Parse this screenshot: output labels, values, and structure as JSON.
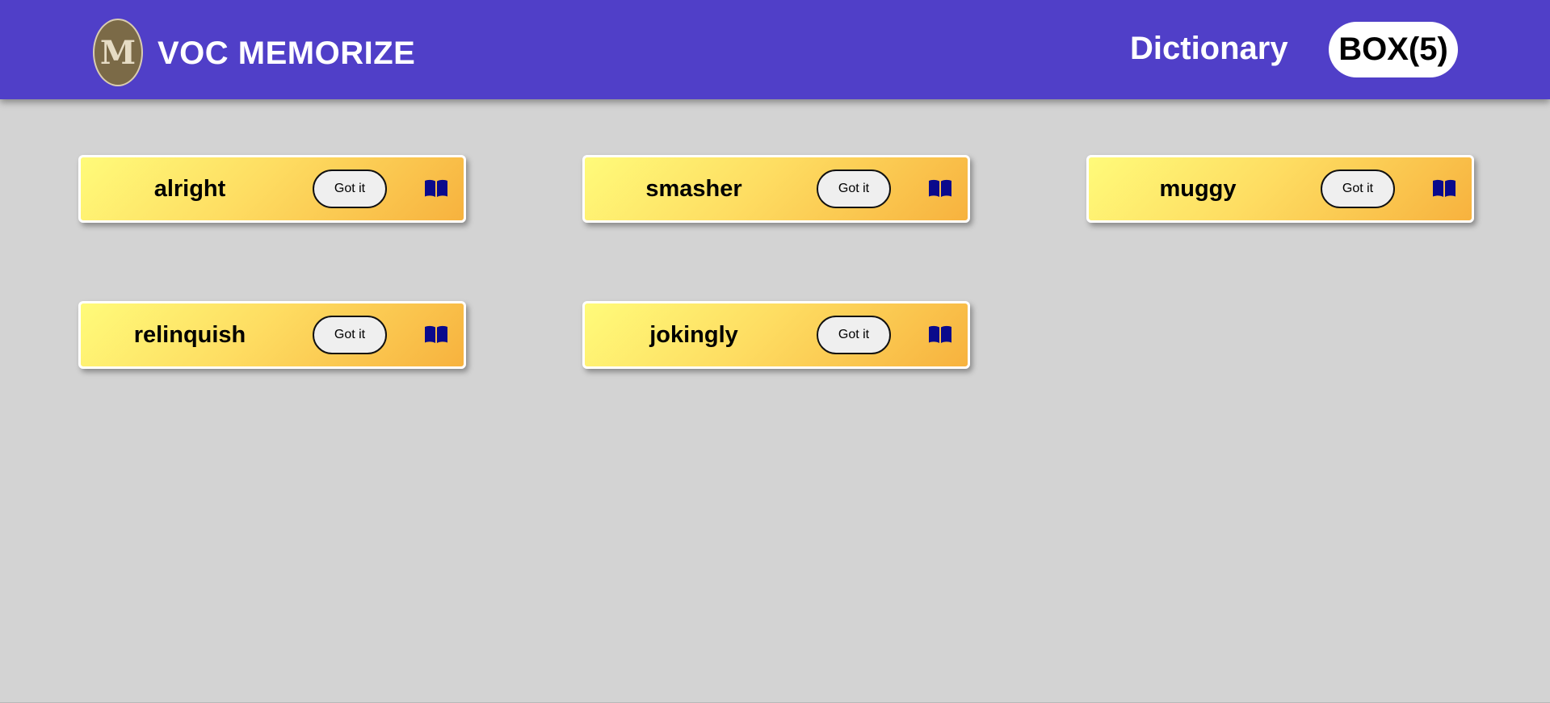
{
  "header": {
    "brand": "VOC MEMORIZE",
    "logo_letter": "M",
    "nav": {
      "dictionary": "Dictionary",
      "box": "BOX(5)"
    },
    "background_color": "#503fc8"
  },
  "cards": [
    {
      "word": "alright",
      "button_label": "Got it",
      "icon": "book-icon"
    },
    {
      "word": "smasher",
      "button_label": "Got it",
      "icon": "book-icon"
    },
    {
      "word": "muggy",
      "button_label": "Got it",
      "icon": "book-icon"
    },
    {
      "word": "relinquish",
      "button_label": "Got it",
      "icon": "book-icon"
    },
    {
      "word": "jokingly",
      "button_label": "Got it",
      "icon": "book-icon"
    }
  ],
  "colors": {
    "page_background": "#d3d3d3",
    "card_gradient_start": "#fffb7a",
    "card_gradient_end": "#f7b23e",
    "icon_color": "#0a0a8c"
  }
}
